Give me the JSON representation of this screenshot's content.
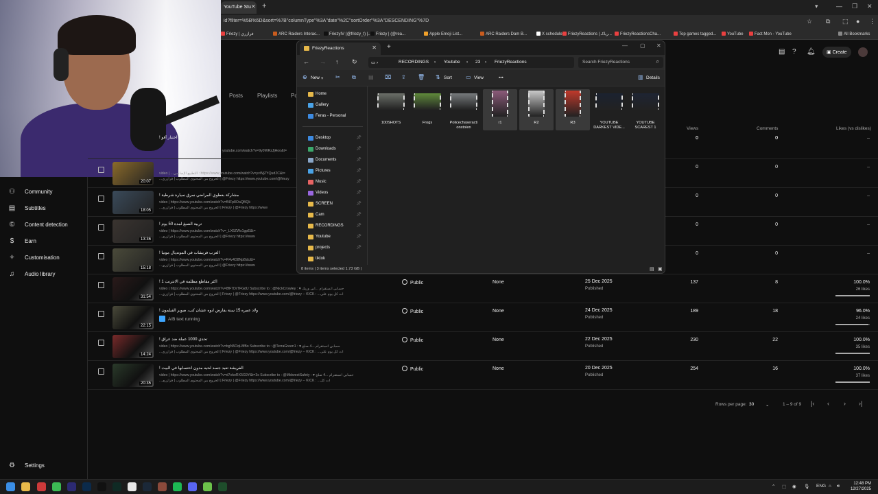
{
  "browser": {
    "tab_title": "YouTube Stu",
    "url": "id?filter=%5B%5D&sort=%7B\"columnType\"%3A\"date\"%2C\"sortOrder\"%3A\"DESCENDING\"%7D",
    "bookmarks": [
      {
        "label": "Friezy | فرازري",
        "color": "#e94040"
      },
      {
        "label": "ARC Raiders Interac...",
        "color": "#c95c1e"
      },
      {
        "label": "FriezyIV (@friezy_t) |...",
        "color": "#111111"
      },
      {
        "label": "Friezy | (@rea...",
        "color": "#111111"
      },
      {
        "label": "Apple Emoji List...",
        "color": "#f0a02a"
      },
      {
        "label": "ARC Raiders Dam B...",
        "color": "#c95c1e"
      },
      {
        "label": "X schedule",
        "color": "#ffffff"
      },
      {
        "label": "FriezyReactions | رياكـ...",
        "color": "#e94040"
      },
      {
        "label": "FriezyReactionsCha...",
        "color": "#e94040"
      },
      {
        "label": "Top games tagged...",
        "color": "#e94040"
      },
      {
        "label": "YouTube",
        "color": "#e94040"
      },
      {
        "label": "Fact Mon - YouTube",
        "color": "#e94040"
      }
    ],
    "all_bookmarks": "All Bookmarks"
  },
  "studio": {
    "create_label": "Create",
    "tabs": [
      "Posts",
      "Playlists",
      "Po"
    ],
    "columns": {
      "views": "Views",
      "comments": "Comments",
      "likes": "Likes (vs dislikes)"
    },
    "nav": [
      {
        "label": "Community",
        "icon": "community-icon"
      },
      {
        "label": "Subtitles",
        "icon": "subtitles-icon"
      },
      {
        "label": "Content detection",
        "icon": "copyright-icon"
      },
      {
        "label": "Earn",
        "icon": "dollar-icon"
      },
      {
        "label": "Customisation",
        "icon": "magic-wand-icon"
      },
      {
        "label": "Audio library",
        "icon": "audio-library-icon"
      }
    ],
    "settings_label": "Settings",
    "hidden_rows": [
      {
        "desc": "youtube.com/watch?v=9y0WRzJjHoo&t=",
        "views": "0",
        "comments": "0",
        "likes": "–"
      },
      {
        "title": "! اختبار أقو",
        "desc": "",
        "views": "0",
        "comments": "0",
        "likes": "–"
      },
      {
        "title": "",
        "duration": "20:07",
        "desc1": "video | ...التطبيع الإساسي : https://www.youtube.com/watch?v=yvWjZYQud2C&t=",
        "desc2": "...الخروج من المحتوى المطلوب | فرازري | @Friezy https://www.youtube.com/@friezy",
        "views": "0",
        "comments": "0",
        "likes": "–"
      },
      {
        "title": "! مشاركة بعطوي المراضي سرق سيارة شرطية",
        "duration": "18:05",
        "desc1": "video | https://www.youtube.com/watch?v=fNFp8OaQBQk",
        "desc2": "...الخروج من المحتوى المطلوب | فرازري | Friezy | @Friezy https://www",
        "views": "0",
        "comments": "0",
        "likes": "–"
      },
      {
        "title": "! تربية الصبغ لمدة 50 يوم",
        "duration": "13:36",
        "desc1": "video | https://www.youtube.com/watch?v=_LX6ZWs1gpE&t=",
        "desc2": "...الخروج من المحتوى المطلوب | فرازري | @Friezy https://www",
        "views": "0",
        "comments": "0",
        "likes": "–"
      },
      {
        "title": "! العرب فريشات في المونديال مونيا",
        "duration": "15:18",
        "desc1": "video | https://www.youtube.com/watch?v=R4v4D8NpBdc&t=",
        "desc2": "...الخروج من المحتوى المطلوب | فرازري | @Friezy https://www",
        "views": "0",
        "comments": "0",
        "likes": "–"
      }
    ],
    "rows": [
      {
        "title": "! اكثر مقاطع مظلمة في الانترنت 1",
        "duration": "31:54",
        "desc1": "video | https://www.youtube.com/watch?v=8fF7DrTFGdU Subscribe to : @NickCrowley : ♥ حسابي انستقرام ...ابي وريك",
        "desc2": "...الخروج من المحتوى المطلوب | فرازري | Friezy | @Friezy https://www.youtube.com/@friezy -- KICK : ...ات كل يوم على",
        "visibility": "Public",
        "restrictions": "None",
        "date": "25 Dec 2025",
        "status": "Published",
        "views": "137",
        "comments": "8",
        "likes": "100.0%",
        "likes_sub": "26 likes",
        "like_ratio": 1.0
      },
      {
        "title": "! ولاد عمره 15 سنة يفارض ابوه عشان كب، صوبر الفيلمون",
        "duration": "22:15",
        "ab": "A/B text running",
        "visibility": "Public",
        "restrictions": "None",
        "date": "24 Dec 2025",
        "status": "Published",
        "views": "189",
        "comments": "18",
        "likes": "96.0%",
        "likes_sub": "24 likes",
        "like_ratio": 0.96
      },
      {
        "title": "! تحدي 1000 عملة ضد عراق",
        "duration": "14:24",
        "desc1": "video | https://www.youtube.com/watch?v=bgN5OqL8fBo Subscribe to : @TerraGreen1 : ♥ حسابي انستقرام ...4 صلح",
        "desc2": "...الخروج من المحتوى المطلوب | فرازري | Friezy | @Friezy https://www.youtube.com/@friezy -- KICK : ...ات كل يوم على",
        "visibility": "Public",
        "restrictions": "None",
        "date": "22 Dec 2025",
        "status": "Published",
        "views": "230",
        "comments": "22",
        "likes": "100.0%",
        "likes_sub": "35 likes",
        "like_ratio": 1.0
      },
      {
        "title": "! الفريشة تعيد جسد لحيه مدون احتسابها في البيت",
        "duration": "20:35",
        "desc1": "video | https://www.youtube.com/watch?v=d7okoRX5G9Y&t=3s Subscribe to : @MidwestSafety : ♥ حسابي انستقرام ...4 صلح",
        "desc2": "...الخروج من المحتوى المطلوب | فرازري | Friezy | @Friezy https://www.youtube.com/@friezy -- KICK : ...ات كل",
        "visibility": "Public",
        "restrictions": "None",
        "date": "20 Dec 2025",
        "status": "Published",
        "views": "254",
        "comments": "16",
        "likes": "100.0%",
        "likes_sub": "37 likes",
        "like_ratio": 1.0
      }
    ],
    "pagination": {
      "rows_label": "Rows per page:",
      "rows_value": "30",
      "range": "1 – 9 of 9"
    }
  },
  "explorer": {
    "tab_title": "FriezyReactions",
    "breadcrumbs": [
      "RECORDINGS",
      "Youtube",
      "23",
      "FriezyReactions"
    ],
    "search_placeholder": "Search FriezyReactions",
    "commands": {
      "new": "New",
      "sort": "Sort",
      "view": "View",
      "details": "Details"
    },
    "sidebar": [
      {
        "label": "Home",
        "color": "#e7b94a"
      },
      {
        "label": "Gallery",
        "color": "#4aa3e7"
      },
      {
        "label": "Feras - Personal",
        "color": "#3d8ae0"
      },
      {
        "label": "Desktop",
        "color": "#3d8ae0"
      },
      {
        "label": "Downloads",
        "color": "#3ba86b"
      },
      {
        "label": "Documents",
        "color": "#8aa7c9"
      },
      {
        "label": "Pictures",
        "color": "#4aa3e7"
      },
      {
        "label": "Music",
        "color": "#e86464"
      },
      {
        "label": "Videos",
        "color": "#9a67e0"
      },
      {
        "label": "SCREEN",
        "color": "#e7b94a"
      },
      {
        "label": "Cam",
        "color": "#e7b94a"
      },
      {
        "label": "RECORDINGS",
        "color": "#e7b94a"
      },
      {
        "label": "Youtube",
        "color": "#e7b94a"
      },
      {
        "label": "projects",
        "color": "#e7b94a"
      },
      {
        "label": "tiktok",
        "color": "#e7b94a"
      }
    ],
    "files": [
      {
        "name": "100SHOTS",
        "tall": false,
        "color": "#6b6f68",
        "sel": false
      },
      {
        "name": "Frogs",
        "tall": false,
        "color": "#5f8a3b",
        "sel": false
      },
      {
        "name": "Policechaseracti onstolen",
        "tall": false,
        "color": "#767a7c",
        "sel": false
      },
      {
        "name": "r1",
        "tall": true,
        "color": "#8b5a79",
        "sel": true
      },
      {
        "name": "R2",
        "tall": true,
        "color": "#c9c9c9",
        "sel": true
      },
      {
        "name": "R3",
        "tall": true,
        "color": "#c0392b",
        "sel": true
      },
      {
        "name": "YOUTUBE DARKEST VIDE...",
        "tall": false,
        "color": "#1b2230",
        "sel": false
      },
      {
        "name": "YOUTUBE SCAREST 1",
        "tall": false,
        "color": "#1e2433",
        "sel": false
      }
    ],
    "status": "8 items  |  3 items selected  1.73 GB  |"
  },
  "taskbar": {
    "lang": "ENG",
    "time": "12:48 PM",
    "date": "12/27/2025",
    "apps": [
      {
        "name": "start-icon",
        "color": "#3a8ee6"
      },
      {
        "name": "file-explorer-icon",
        "color": "#e7b94a"
      },
      {
        "name": "app-icon-red",
        "color": "#cc3a3a"
      },
      {
        "name": "chrome-icon",
        "color": "#3cba54"
      },
      {
        "name": "premiere-icon",
        "color": "#2c2a72"
      },
      {
        "name": "photoshop-icon",
        "color": "#0b2a4a"
      },
      {
        "name": "tiktok-icon",
        "color": "#111111"
      },
      {
        "name": "capcut-icon",
        "color": "#0f2a24"
      },
      {
        "name": "obs-icon",
        "color": "#e8e8e8"
      },
      {
        "name": "steam-icon",
        "color": "#1b2838"
      },
      {
        "name": "winrar-icon",
        "color": "#8b4a3b"
      },
      {
        "name": "spotify-icon",
        "color": "#1db954"
      },
      {
        "name": "discord-icon",
        "color": "#5865f2"
      },
      {
        "name": "app-icon-green",
        "color": "#6cc24a"
      },
      {
        "name": "terminal-icon",
        "color": "#1e4d2b"
      }
    ]
  }
}
